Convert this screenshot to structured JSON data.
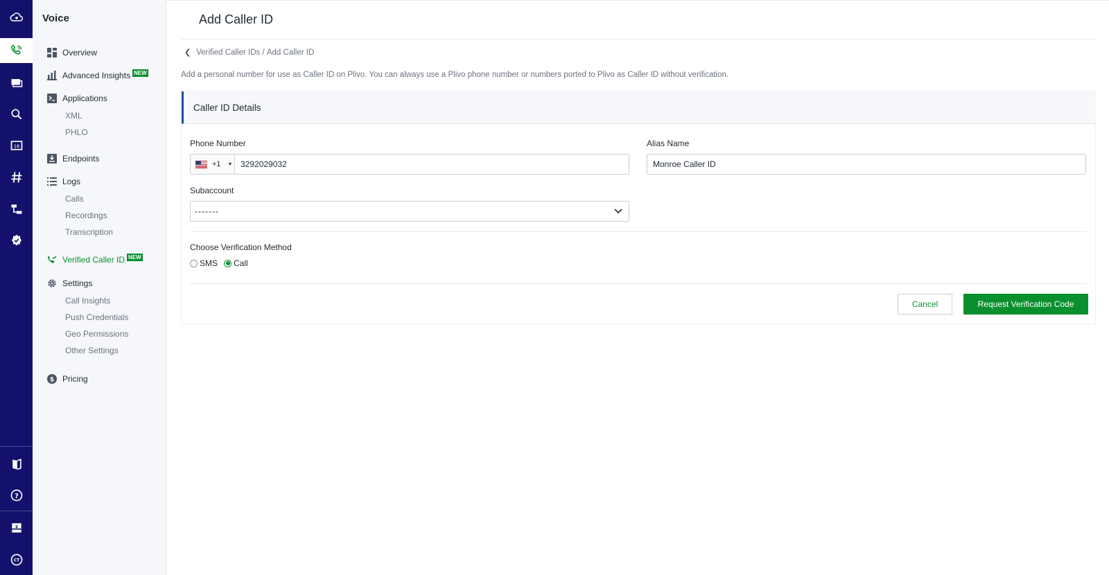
{
  "rail": {
    "items": [
      {
        "icon": "cloud-logo-icon"
      },
      {
        "icon": "phone-icon",
        "active": true
      },
      {
        "icon": "messaging-icon"
      },
      {
        "icon": "lookup-icon"
      },
      {
        "icon": "number-icon"
      },
      {
        "icon": "hash-icon"
      },
      {
        "icon": "flow-icon"
      },
      {
        "icon": "verified-badge-icon"
      },
      {
        "icon": "docs-icon"
      },
      {
        "icon": "help-icon"
      },
      {
        "icon": "billing-icon"
      },
      {
        "icon": "account-icon"
      }
    ]
  },
  "sidebar": {
    "title": "Voice",
    "overview": "Overview",
    "advanced_insights": "Advanced Insights",
    "applications": "Applications",
    "xml": "XML",
    "phlo": "PHLO",
    "endpoints": "Endpoints",
    "logs": "Logs",
    "calls": "Calls",
    "recordings": "Recordings",
    "transcription": "Transcription",
    "verified_caller_id": "Verified Caller ID",
    "settings": "Settings",
    "call_insights": "Call Insights",
    "push_credentials": "Push Credentials",
    "geo_permissions": "Geo Permissions",
    "other_settings": "Other Settings",
    "pricing": "Pricing",
    "new_badge": "NEW"
  },
  "main": {
    "title": "Add Caller ID",
    "breadcrumb_parent": "Verified Caller IDs",
    "breadcrumb_sep": " / ",
    "breadcrumb_current": "Add Caller ID",
    "intro": "Add a personal number for use as Caller ID on Plivo. You can always use a Plivo phone number or numbers ported to Plivo as Caller ID without verification.",
    "card_title": "Caller ID Details",
    "phone_label": "Phone Number",
    "phone_dial_code": "+1",
    "phone_value": "3292029032",
    "alias_label": "Alias Name",
    "alias_value": "Monroe Caller ID",
    "subaccount_label": "Subaccount",
    "subaccount_value": "-------",
    "method_label": "Choose Verification Method",
    "method_sms": "SMS",
    "method_call": "Call",
    "selected_method": "Call",
    "cancel_label": "Cancel",
    "submit_label": "Request Verification Code"
  },
  "colors": {
    "rail_bg": "#13116b",
    "accent_green": "#0a8f2e",
    "card_accent": "#1f4fa8"
  }
}
